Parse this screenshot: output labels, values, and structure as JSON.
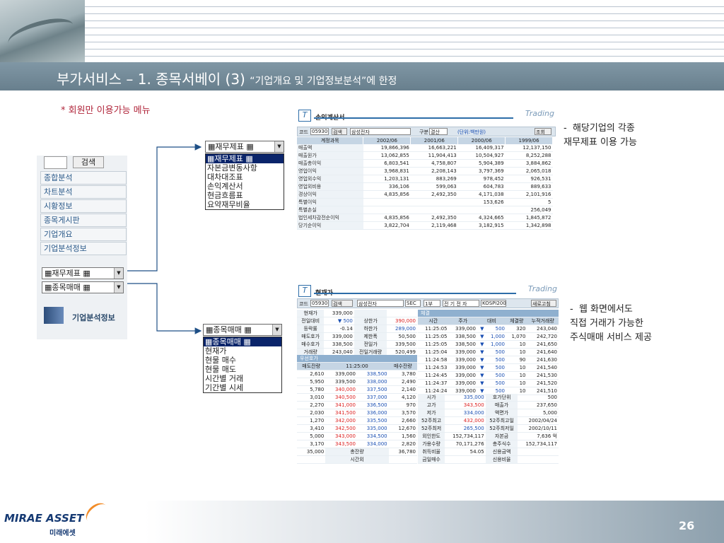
{
  "slide": {
    "title": "부가서비스 – 1. 종목서베이 (3)",
    "subtitle": "“기업개요 및 기업정보분석”에 한정",
    "member_note": "* 회원만 이용가능 메뉴",
    "note1": "-  해당기업의 각종\n재무제표 이용 가능",
    "note2": "-  웹 화면에서도\n직접 거래가 가능한\n주식매매 서비스 제공",
    "page_number": "26"
  },
  "left_menu": {
    "search_button": "검색",
    "items": [
      "종합분석",
      "차트분석",
      "시황정보",
      "종목게시판",
      "기업개요",
      "기업분석정보"
    ],
    "select1": "▦재무제표 ▦",
    "select2": "▦종목매매 ▦",
    "corp_info_label": "기업분석정보"
  },
  "dropdown1": {
    "header": "▦재무제표 ▦",
    "options": [
      "▦재무제표 ▦",
      "자본금변동사항",
      "대차대조표",
      "손익계산서",
      "현금흐름표",
      "요약재무비율"
    ]
  },
  "dropdown2": {
    "header": "▦종목매매 ▦",
    "options": [
      "▦종목매매 ▦",
      "현재가",
      "현물 매수",
      "현물 매도",
      "시간별 거래",
      "기간별 시세"
    ]
  },
  "income": {
    "title": "손익계산서",
    "trading": "Trading",
    "code_label": "코드",
    "code": "05930",
    "search": "검색",
    "name": "삼성전자",
    "gubun_label": "구분",
    "gubun": "결산",
    "unit": "(단위:백만원)",
    "query": "조회",
    "headers": [
      "계정과목",
      "2002/06",
      "2001/06",
      "2000/06",
      "1999/06"
    ],
    "rows": [
      [
        "매출액",
        "19,866,396",
        "16,663,221",
        "16,409,317",
        "12,137,150"
      ],
      [
        "매출원가",
        "13,062,855",
        "11,904,413",
        "10,504,927",
        "8,252,288"
      ],
      [
        "매출총이익",
        "6,803,541",
        "4,758,807",
        "5,904,389",
        "3,884,862"
      ],
      [
        "영업이익",
        "3,968,831",
        "2,208,143",
        "3,797,369",
        "2,065,018"
      ],
      [
        "영업외수익",
        "1,203,131",
        "883,269",
        "978,452",
        "926,531"
      ],
      [
        "영업외비용",
        "336,106",
        "599,063",
        "604,783",
        "889,633"
      ],
      [
        "경상이익",
        "4,835,856",
        "2,492,350",
        "4,171,038",
        "2,101,916"
      ],
      [
        "특별이익",
        "",
        "",
        "153,626",
        "5"
      ],
      [
        "특별손실",
        "",
        "",
        "",
        "256,049"
      ],
      [
        "법인세차감전순이익",
        "4,835,856",
        "2,492,350",
        "4,324,665",
        "1,845,872"
      ],
      [
        "당기순이익",
        "3,822,704",
        "2,119,468",
        "3,182,915",
        "1,342,898"
      ]
    ]
  },
  "quote": {
    "title": "현재가",
    "trading": "Trading",
    "code_label": "코드",
    "code": "05930",
    "search": "검색",
    "name": "삼성전자",
    "sec": "SEC",
    "board": "1부",
    "sector": "전 기 전 자",
    "index": "KOSPI200",
    "refresh": "새로고침",
    "summary": [
      [
        "현재가",
        "339,000",
        "",
        ""
      ],
      [
        "전일대비",
        "▼ 500",
        "상한가",
        "390,000"
      ],
      [
        "등락률",
        "-0.14",
        "하한가",
        "289,000"
      ],
      [
        "매도호가",
        "339,000",
        "제한폭",
        "50,500"
      ],
      [
        "매수호가",
        "338,500",
        "전일가",
        "339,500"
      ],
      [
        "거래량",
        "243,040",
        "전일거래량",
        "520,499"
      ]
    ],
    "ask_label": "우선호가",
    "book_headers": [
      "매도잔량",
      "11:25:00",
      "매수잔량"
    ],
    "book": [
      [
        "2,610",
        "339,000",
        "338,500",
        "3,780"
      ],
      [
        "5,950",
        "339,500",
        "338,000",
        "2,490"
      ],
      [
        "5,780",
        "340,000",
        "337,500",
        "2,140"
      ],
      [
        "3,010",
        "340,500",
        "337,000",
        "4,120"
      ],
      [
        "2,270",
        "341,000",
        "336,500",
        "970"
      ],
      [
        "2,030",
        "341,500",
        "336,000",
        "3,570"
      ],
      [
        "1,270",
        "342,000",
        "335,500",
        "2,660"
      ],
      [
        "3,410",
        "342,500",
        "335,000",
        "12,670"
      ],
      [
        "5,000",
        "343,000",
        "334,500",
        "1,560"
      ],
      [
        "3,170",
        "343,500",
        "334,000",
        "2,820"
      ]
    ],
    "book_total": [
      "35,000",
      "총잔량",
      "36,780"
    ],
    "book_after": "시간외",
    "trade_label": "체결",
    "trade_headers": [
      "시간",
      "주가",
      "대비",
      "체결량",
      "누적거래량"
    ],
    "trades": [
      [
        "11:25:05",
        "339,000",
        "▼",
        "500",
        "320",
        "243,040"
      ],
      [
        "11:25:05",
        "338,500",
        "▼",
        "1,000",
        "1,070",
        "242,720"
      ],
      [
        "11:25:05",
        "338,500",
        "▼",
        "1,000",
        "10",
        "241,650"
      ],
      [
        "11:25:04",
        "339,000",
        "▼",
        "500",
        "10",
        "241,640"
      ],
      [
        "11:24:58",
        "339,000",
        "▼",
        "500",
        "90",
        "241,630"
      ],
      [
        "11:24:53",
        "339,000",
        "▼",
        "500",
        "10",
        "241,540"
      ],
      [
        "11:24:45",
        "339,000",
        "▼",
        "500",
        "10",
        "241,530"
      ],
      [
        "11:24:37",
        "339,000",
        "▼",
        "500",
        "10",
        "241,520"
      ],
      [
        "11:24:24",
        "339,000",
        "▼",
        "500",
        "10",
        "241,510"
      ]
    ],
    "stats": [
      [
        "시가",
        "335,000",
        "호가단위",
        "500"
      ],
      [
        "고가",
        "343,500",
        "매출가",
        "237,650"
      ],
      [
        "저가",
        "334,000",
        "액면가",
        "5,000"
      ],
      [
        "52주최고",
        "432,000",
        "52주최고일",
        "2002/04/24"
      ],
      [
        "52주최저",
        "265,500",
        "52주최저일",
        "2002/10/11"
      ],
      [
        "외인한도",
        "152,734,117",
        "자본금",
        "7,636 억"
      ],
      [
        "가용수량",
        "70,171,276",
        "총주식수",
        "152,734,117"
      ],
      [
        "취득비율",
        "54.05",
        "신용금액",
        ""
      ],
      [
        "금일매수",
        "",
        "신용비율",
        ""
      ]
    ]
  },
  "footer": {
    "logo": "MIRAE ASSET",
    "logo_kr": "미래에셋"
  },
  "colors": {
    "title_bar": "#6f8695",
    "accent": "#b0263b",
    "panel_blue": "#2d6da8"
  }
}
